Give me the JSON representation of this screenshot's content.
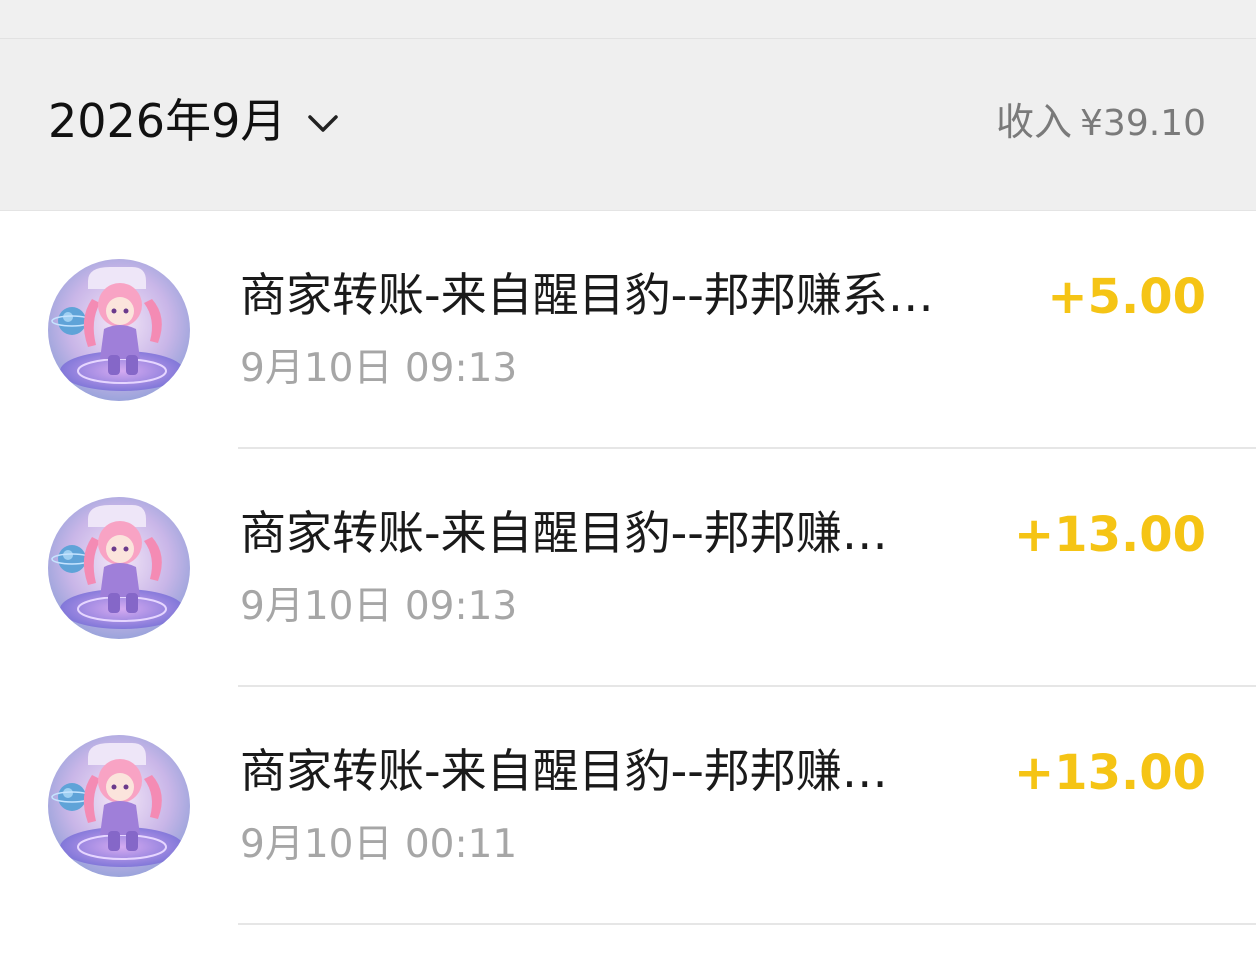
{
  "header": {
    "month_label": "2026年9月",
    "income_label": "收入",
    "income_amount": "¥39.10"
  },
  "transactions": [
    {
      "title": "商家转账-来自醒目豹--邦邦赚系…",
      "time": "9月10日 09:13",
      "amount": "+5.00"
    },
    {
      "title": "商家转账-来自醒目豹--邦邦赚…",
      "time": "9月10日 09:13",
      "amount": "+13.00"
    },
    {
      "title": "商家转账-来自醒目豹--邦邦赚…",
      "time": "9月10日 00:11",
      "amount": "+13.00"
    }
  ],
  "colors": {
    "amount": "#f5c415",
    "header_bg": "#efefef",
    "secondary_text": "#a6a6a6"
  },
  "icons": {
    "month_dropdown": "chevron-down-icon",
    "avatar": "anime-girl-avatar"
  }
}
